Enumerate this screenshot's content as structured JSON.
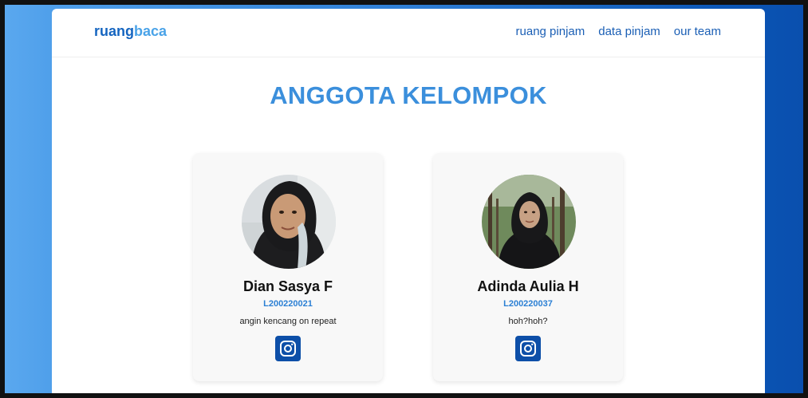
{
  "navbar": {
    "brand_part1": "ruang",
    "brand_part2": "baca",
    "links": [
      "ruang pinjam",
      "data pinjam",
      "our team"
    ]
  },
  "title": "ANGGOTA KELOMPOK",
  "members": [
    {
      "name": "Dian Sasya F",
      "id": "L200220021",
      "bio": "angin kencang on repeat",
      "social_icon": "instagram-icon"
    },
    {
      "name": "Adinda Aulia H",
      "id": "L200220037",
      "bio": "hoh?hoh?",
      "social_icon": "instagram-icon"
    }
  ],
  "colors": {
    "brand_dark": "#1565c0",
    "brand_light": "#4aa3e8",
    "title": "#3b8fdc",
    "id_text": "#2a7fd4",
    "social_button": "#0d4fa8"
  }
}
